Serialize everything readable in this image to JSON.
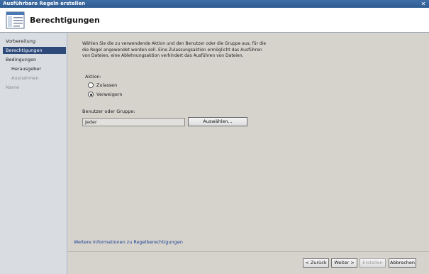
{
  "window": {
    "title": "Ausführbare Regeln erstellen",
    "close_glyph": "✕"
  },
  "header": {
    "title": "Berechtigungen",
    "icon": "wizard-page-icon"
  },
  "sidebar": {
    "items": [
      {
        "label": "Vorbereitung",
        "state": "normal"
      },
      {
        "label": "Berechtigungen",
        "state": "active"
      },
      {
        "label": "Bedingungen",
        "state": "normal"
      },
      {
        "label": "Herausgeber",
        "state": "normal"
      },
      {
        "label": "Ausnahmen",
        "state": "disabled"
      },
      {
        "label": "Name",
        "state": "disabled"
      }
    ]
  },
  "main": {
    "intro": "Wählen Sie die zu verwendende Aktion und den Benutzer oder die Gruppe aus, für die die Regel angewendet werden soll. Eine Zulassungsaktion ermöglicht das Ausführen von Dateien, eine Ablehnungsaktion verhindert das Ausführen von Dateien.",
    "action_label": "Aktion:",
    "actions": [
      {
        "label": "Zulassen",
        "checked": false
      },
      {
        "label": "Verweigern",
        "checked": true
      }
    ],
    "user_label": "Benutzer oder Gruppe:",
    "user_value": "Jeder",
    "select_button": "Auswählen...",
    "more_info_link": "Weitere Informationen zu Regelberechtigungen"
  },
  "footer": {
    "back": "< Zurück",
    "next": "Weiter >",
    "create": "Erstellen",
    "cancel": "Abbrechen"
  }
}
